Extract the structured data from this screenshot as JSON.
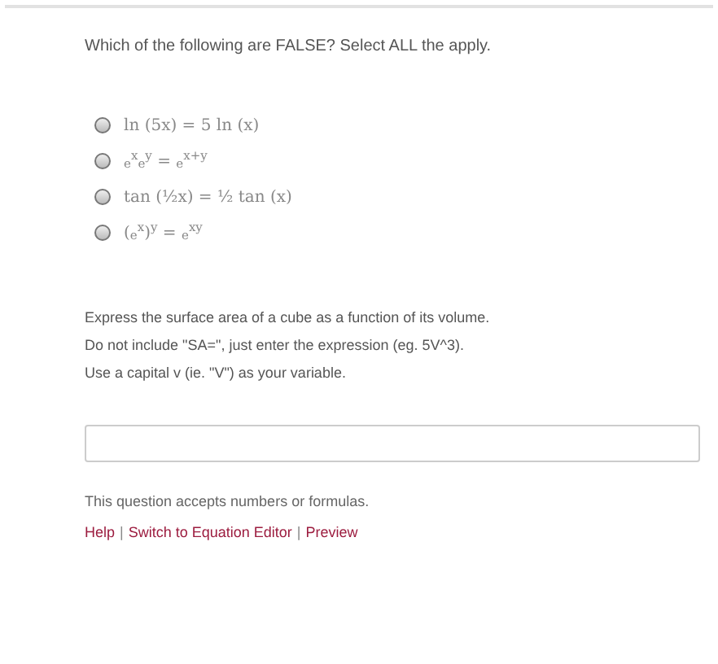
{
  "question_1": {
    "prompt": "Which of the following are FALSE? Select ALL the apply.",
    "options": [
      {
        "text": "ln (5x) = 5 ln (x)",
        "selected": false
      },
      {
        "text": "$_{e}$$^{x}$$_{e}$$^{y}$ = $_{e}$$^{x+y}$",
        "selected": false
      },
      {
        "text": "tan (½x) = ½ tan (x)",
        "selected": false
      },
      {
        "text": "($_{e}$$^{x}$)$^{y}$ = $_{e}$$^{xy}$",
        "selected": false
      }
    ]
  },
  "question_2": {
    "instructions": [
      "Express the surface area of a cube as a function of its volume.",
      "Do not include \"SA=\", just enter the expression (eg. 5V^3).",
      "Use a capital v (ie. \"V\") as your variable."
    ],
    "note": "This question accepts numbers or formulas.",
    "links": [
      {
        "kind": "link",
        "text": "Help"
      },
      {
        "kind": "separator",
        "text": "|"
      },
      {
        "kind": "link",
        "text": "Switch to Equation Editor"
      },
      {
        "kind": "separator",
        "text": "|"
      },
      {
        "kind": "link",
        "text": "Preview"
      }
    ]
  }
}
